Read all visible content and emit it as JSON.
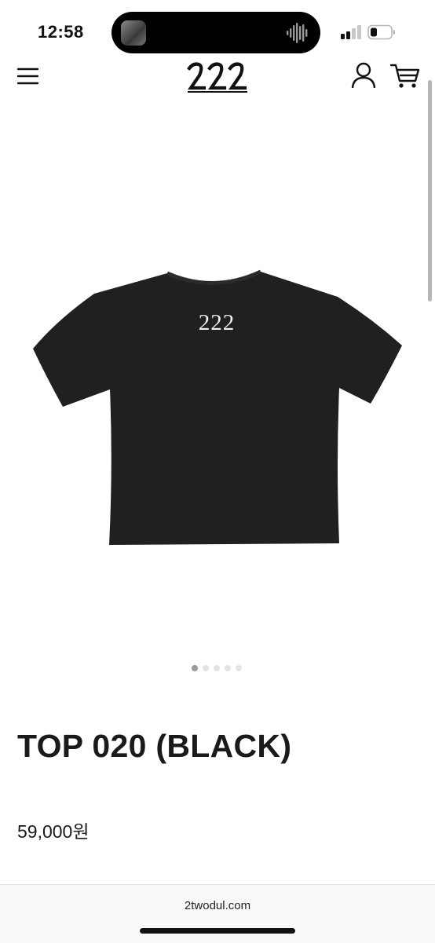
{
  "status_bar": {
    "time": "12:58",
    "signal_icon": "cellular-signal-icon",
    "battery_icon": "battery-low-icon"
  },
  "header": {
    "menu_icon": "hamburger-menu-icon",
    "logo_text": "222",
    "account_icon": "user-icon",
    "cart_icon": "cart-icon"
  },
  "product": {
    "image_print": "222",
    "title": "TOP 020 (BLACK)",
    "price": "59,000원",
    "image_count": 5,
    "active_image": 1
  },
  "browser": {
    "url": "2twodul.com"
  },
  "colors": {
    "shirt": "#202022",
    "accent_dot": "#9a9a9a"
  }
}
